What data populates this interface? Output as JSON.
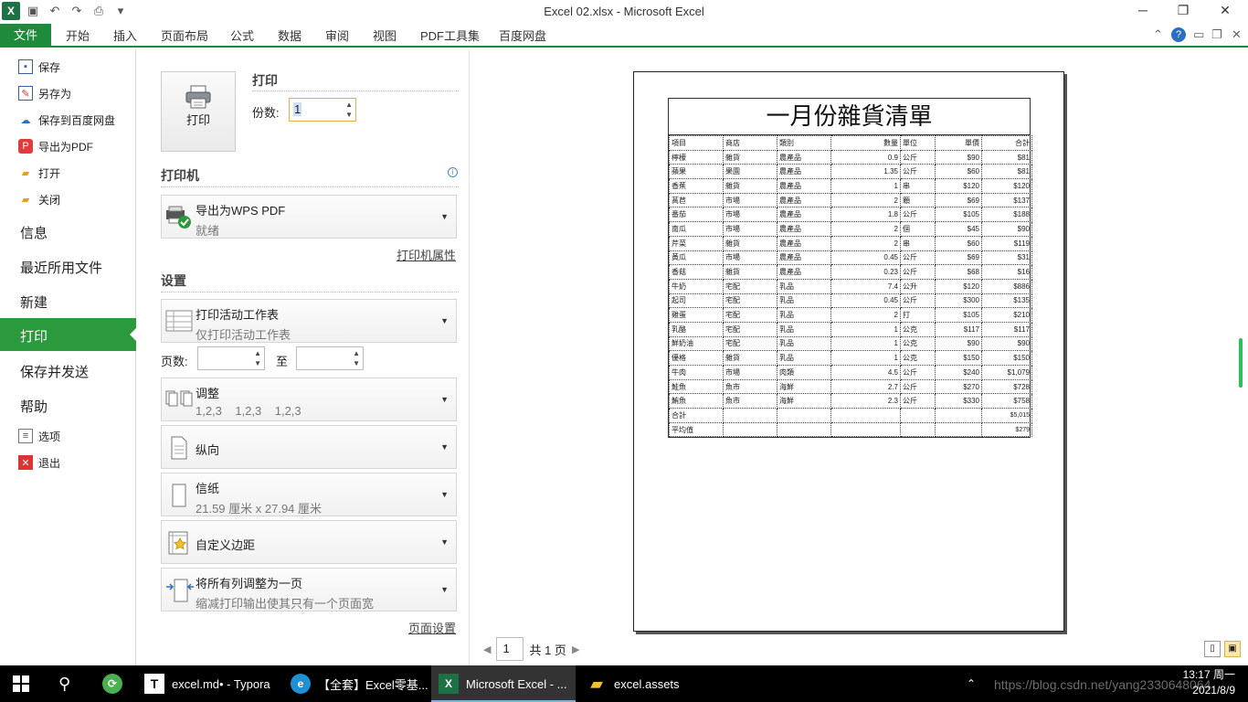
{
  "window": {
    "title": "Excel 02.xlsx  -  Microsoft Excel"
  },
  "ribbon": {
    "file_label": "文件",
    "tabs": [
      "开始",
      "插入",
      "页面布局",
      "公式",
      "数据",
      "审阅",
      "视图",
      "PDF工具集",
      "百度网盘"
    ]
  },
  "nav": {
    "small_top": [
      "保存",
      "另存为",
      "保存到百度网盘",
      "导出为PDF",
      "打开",
      "关闭"
    ],
    "big": [
      "信息",
      "最近所用文件",
      "新建",
      "打印",
      "保存并发送",
      "帮助"
    ],
    "small_bottom": [
      "选项",
      "退出"
    ]
  },
  "print": {
    "section_title": "打印",
    "button_label": "打印",
    "copies_label": "份数:",
    "copies_value": "1"
  },
  "printer": {
    "section_title": "打印机",
    "name": "导出为WPS PDF",
    "status": "就绪",
    "properties_link": "打印机属性"
  },
  "settings": {
    "section_title": "设置",
    "scope_title": "打印活动工作表",
    "scope_desc": "仅打印活动工作表",
    "pages_label": "页数:",
    "pages_to": "至",
    "collate_title": "调整",
    "collate_desc": "1,2,3    1,2,3    1,2,3",
    "orientation": "纵向",
    "paper_title": "信纸",
    "paper_desc": "21.59 厘米 x 27.94 厘米",
    "margins": "自定义边距",
    "scaling_title": "将所有列调整为一页",
    "scaling_desc": "缩减打印输出使其只有一个页面宽",
    "page_setup_link": "页面设置"
  },
  "preview": {
    "sheet_title": "一月份雜貨清單",
    "columns": [
      "項目",
      "商店",
      "類別",
      "數量",
      "單位",
      "單價",
      "合計"
    ],
    "rows": [
      [
        "檸檬",
        "雜貨",
        "農產品",
        "0.9",
        "公斤",
        "$90",
        "$81"
      ],
      [
        "蘋果",
        "果園",
        "農產品",
        "1.35",
        "公斤",
        "$60",
        "$81"
      ],
      [
        "香蕉",
        "雜貨",
        "農產品",
        "1",
        "串",
        "$120",
        "$120"
      ],
      [
        "萵苣",
        "市場",
        "農產品",
        "2",
        "顆",
        "$69",
        "$137"
      ],
      [
        "番茄",
        "市場",
        "農產品",
        "1.8",
        "公斤",
        "$105",
        "$188"
      ],
      [
        "南瓜",
        "市場",
        "農產品",
        "2",
        "個",
        "$45",
        "$90"
      ],
      [
        "芹菜",
        "雜貨",
        "農產品",
        "2",
        "串",
        "$60",
        "$119"
      ],
      [
        "黃瓜",
        "市場",
        "農產品",
        "0.45",
        "公斤",
        "$69",
        "$31"
      ],
      [
        "香菇",
        "雜貨",
        "農產品",
        "0.23",
        "公斤",
        "$68",
        "$16"
      ],
      [
        "牛奶",
        "宅配",
        "乳品",
        "7.4",
        "公升",
        "$120",
        "$886"
      ],
      [
        "起司",
        "宅配",
        "乳品",
        "0.45",
        "公斤",
        "$300",
        "$135"
      ],
      [
        "雞蛋",
        "宅配",
        "乳品",
        "2",
        "打",
        "$105",
        "$210"
      ],
      [
        "乳酪",
        "宅配",
        "乳品",
        "1",
        "公克",
        "$117",
        "$117"
      ],
      [
        "鮮奶油",
        "宅配",
        "乳品",
        "1",
        "公克",
        "$90",
        "$90"
      ],
      [
        "優格",
        "雜貨",
        "乳品",
        "1",
        "公克",
        "$150",
        "$150"
      ],
      [
        "牛肉",
        "市場",
        "肉類",
        "4.5",
        "公斤",
        "$240",
        "$1,079"
      ],
      [
        "鮭魚",
        "魚市",
        "海鮮",
        "2.7",
        "公斤",
        "$270",
        "$728"
      ],
      [
        "鮪魚",
        "魚市",
        "海鮮",
        "2.3",
        "公斤",
        "$330",
        "$758"
      ]
    ],
    "total_label": "合計",
    "total_value": "$5,015",
    "avg_label": "平均值",
    "avg_value": "$279",
    "page_current": "1",
    "page_total": "共 1 页"
  },
  "taskbar": {
    "items": [
      "excel.md• - Typora",
      "【全套】Excel零基...",
      "Microsoft Excel - ...",
      "excel.assets"
    ],
    "time": "13:17 周一",
    "date": "2021/8/9",
    "watermark": "https://blog.csdn.net/yang2330648064"
  },
  "colors": {
    "accent": "#1e8a3c",
    "nav_active": "#2a9a3c"
  }
}
